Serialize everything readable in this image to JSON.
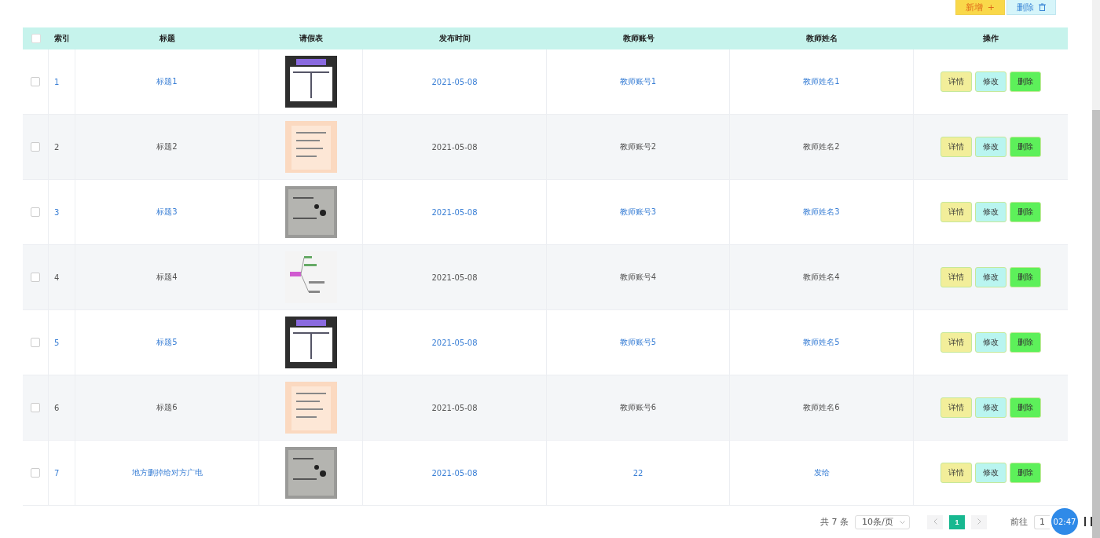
{
  "toolbar": {
    "buttons": [
      {
        "kind": "add",
        "label": "新增",
        "icon": "+"
      },
      {
        "kind": "delete",
        "label": "删除"
      }
    ]
  },
  "table": {
    "select_all": {
      "checked": false
    },
    "columns": [
      "索引",
      "标题",
      "请假表",
      "发布时间",
      "教师账号",
      "教师姓名",
      "操作"
    ],
    "rows": [
      {
        "index": "1",
        "title": "标题1",
        "time": "2021-05-08",
        "account": "教师账号1",
        "name": "教师姓名1",
        "checked": false,
        "actions": [
          {
            "kind": "detail",
            "label": "详情"
          },
          {
            "kind": "edit",
            "label": "修改"
          },
          {
            "kind": "delete",
            "label": "删除"
          }
        ]
      },
      {
        "index": "2",
        "title": "标题2",
        "time": "2021-05-08",
        "account": "教师账号2",
        "name": "教师姓名2",
        "checked": false,
        "actions": [
          {
            "kind": "detail",
            "label": "详情"
          },
          {
            "kind": "edit",
            "label": "修改"
          },
          {
            "kind": "delete",
            "label": "删除"
          }
        ]
      },
      {
        "index": "3",
        "title": "标题3",
        "time": "2021-05-08",
        "account": "教师账号3",
        "name": "教师姓名3",
        "checked": false,
        "actions": [
          {
            "kind": "detail",
            "label": "详情"
          },
          {
            "kind": "edit",
            "label": "修改"
          },
          {
            "kind": "delete",
            "label": "删除"
          }
        ]
      },
      {
        "index": "4",
        "title": "标题4",
        "time": "2021-05-08",
        "account": "教师账号4",
        "name": "教师姓名4",
        "checked": false,
        "actions": [
          {
            "kind": "detail",
            "label": "详情"
          },
          {
            "kind": "edit",
            "label": "修改"
          },
          {
            "kind": "delete",
            "label": "删除"
          }
        ]
      },
      {
        "index": "5",
        "title": "标题5",
        "time": "2021-05-08",
        "account": "教师账号5",
        "name": "教师姓名5",
        "checked": false,
        "actions": [
          {
            "kind": "detail",
            "label": "详情"
          },
          {
            "kind": "edit",
            "label": "修改"
          },
          {
            "kind": "delete",
            "label": "删除"
          }
        ]
      },
      {
        "index": "6",
        "title": "标题6",
        "time": "2021-05-08",
        "account": "教师账号6",
        "name": "教师姓名6",
        "checked": false,
        "actions": [
          {
            "kind": "detail",
            "label": "详情"
          },
          {
            "kind": "edit",
            "label": "修改"
          },
          {
            "kind": "delete",
            "label": "删除"
          }
        ]
      },
      {
        "index": "7",
        "title": "地方删掉给对方广电",
        "time": "2021-05-08",
        "account": "22",
        "name": "发给",
        "checked": false,
        "actions": [
          {
            "kind": "detail",
            "label": "详情"
          },
          {
            "kind": "edit",
            "label": "修改"
          },
          {
            "kind": "delete",
            "label": "删除"
          }
        ]
      }
    ]
  },
  "pagination": {
    "total": "共 7 条",
    "page_size": "10条/页",
    "pages": [
      {
        "label": "1",
        "selected": true
      }
    ],
    "goto_label": "前往",
    "goto_value": "1"
  },
  "recorder": {
    "time": "02:47"
  }
}
